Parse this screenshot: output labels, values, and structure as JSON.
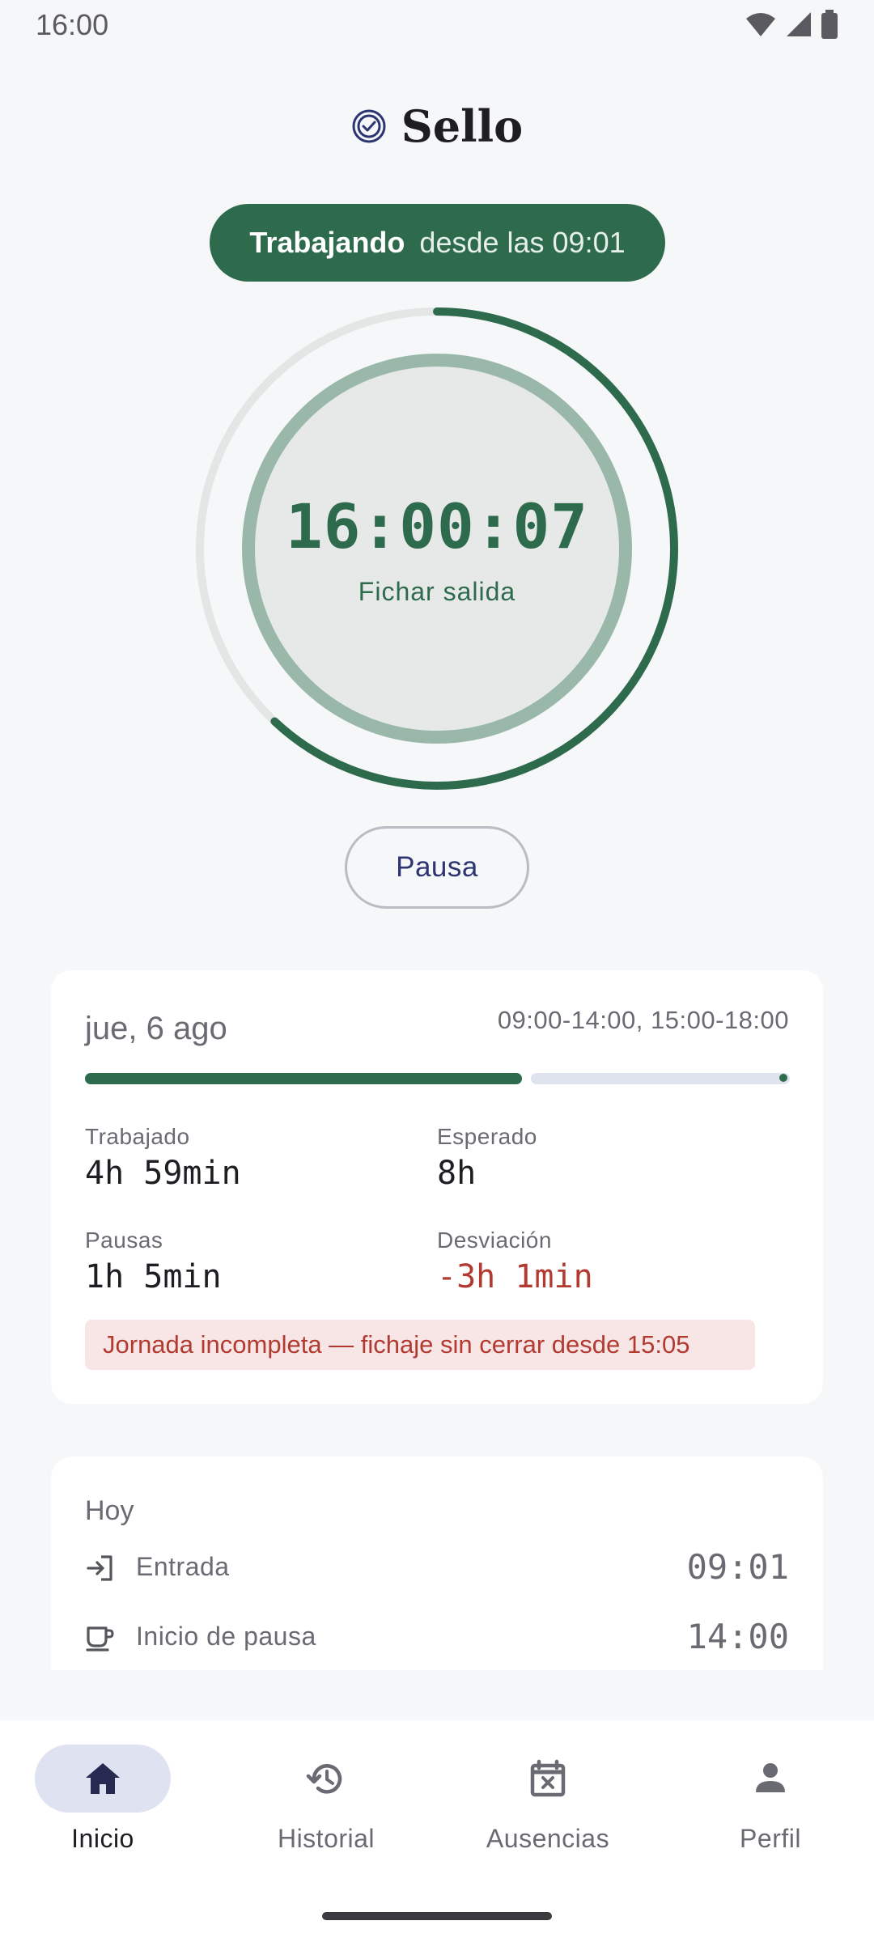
{
  "status_bar": {
    "time": "16:00"
  },
  "app": {
    "title": "Sello"
  },
  "status_pill": {
    "state": "Trabajando",
    "since": "desde las 09:01"
  },
  "clock": {
    "time": "16:00:07",
    "action": "Fichar salida",
    "progress": 0.62
  },
  "pause_button": {
    "label": "Pausa"
  },
  "day_card": {
    "date": "jue, 6 ago",
    "schedule": "09:00-14:00, 15:00-18:00",
    "progress": 0.62,
    "stats": {
      "worked_label": "Trabajado",
      "worked_value": "4h 59min",
      "expected_label": "Esperado",
      "expected_value": "8h",
      "pauses_label": "Pausas",
      "pauses_value": "1h 5min",
      "deviation_label": "Desviación",
      "deviation_value": "-3h 1min"
    },
    "warning": "Jornada incompleta — fichaje sin cerrar desde 15:05"
  },
  "today_card": {
    "title": "Hoy",
    "entries": [
      {
        "label": "Entrada",
        "time": "09:01",
        "icon": "login-icon"
      },
      {
        "label": "Inicio de pausa",
        "time": "14:00",
        "icon": "coffee-icon"
      }
    ]
  },
  "nav": {
    "items": [
      {
        "label": "Inicio",
        "icon": "home-icon",
        "active": true
      },
      {
        "label": "Historial",
        "icon": "history-icon",
        "active": false
      },
      {
        "label": "Ausencias",
        "icon": "calendar-cancel-icon",
        "active": false
      },
      {
        "label": "Perfil",
        "icon": "person-icon",
        "active": false
      }
    ]
  },
  "colors": {
    "accent": "#2e6b4d",
    "negative": "#b23a31",
    "brand": "#2c3570"
  }
}
